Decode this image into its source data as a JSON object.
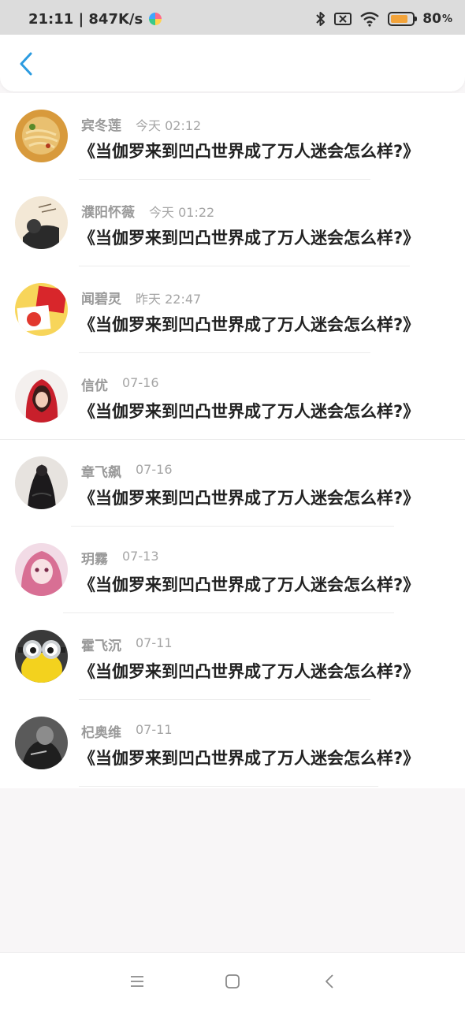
{
  "status_bar": {
    "time_speed": "21:11 | 847K/s",
    "battery_percent": "80",
    "battery_pct_sign": "%",
    "battery_level": 0.8,
    "icons": [
      "bluetooth-icon",
      "sim-card-icon",
      "wifi-icon",
      "battery-icon"
    ]
  },
  "header": {
    "back_icon": "chevron-left-icon",
    "accent_color": "#2b9be0"
  },
  "list": {
    "items": [
      {
        "name": "宾冬莲",
        "time": "今天 02:12",
        "title": "《当伽罗来到凹凸世界成了万人迷会怎么样?》"
      },
      {
        "name": "濮阳怀薇",
        "time": "今天 01:22",
        "title": "《当伽罗来到凹凸世界成了万人迷会怎么样?》"
      },
      {
        "name": "闻碧灵",
        "time": "昨天 22:47",
        "title": "《当伽罗来到凹凸世界成了万人迷会怎么样?》"
      },
      {
        "name": "信优",
        "time": "07-16",
        "title": "《当伽罗来到凹凸世界成了万人迷会怎么样?》"
      },
      {
        "name": "章飞飙",
        "time": "07-16",
        "title": "《当伽罗来到凹凸世界成了万人迷会怎么样?》"
      },
      {
        "name": "玥霧",
        "time": "07-13",
        "title": "《当伽罗来到凹凸世界成了万人迷会怎么样?》"
      },
      {
        "name": "霍飞沉",
        "time": "07-11",
        "title": "《当伽罗来到凹凸世界成了万人迷会怎么样?》"
      },
      {
        "name": "杞奥维",
        "time": "07-11",
        "title": "《当伽罗来到凹凸世界成了万人迷会怎么样?》"
      }
    ]
  },
  "nav_bar": {
    "icons": [
      "menu-icon",
      "home-square-icon",
      "back-chevron-icon"
    ]
  }
}
